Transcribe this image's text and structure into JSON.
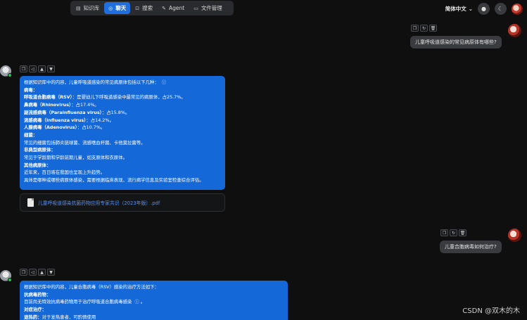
{
  "nav": {
    "tabs": [
      {
        "label": "知识库",
        "icon": "book-icon"
      },
      {
        "label": "聊天",
        "icon": "chat-icon",
        "active": true
      },
      {
        "label": "搜索",
        "icon": "search-icon"
      },
      {
        "label": "Agent",
        "icon": "agent-icon"
      },
      {
        "label": "文件管理",
        "icon": "folder-icon"
      }
    ],
    "language": "简体中文"
  },
  "messages": {
    "user1": "儿童呼吸道感染的常见病原体有哪些?",
    "bot1": {
      "intro": "根据知识库中的内容，儿童呼吸道感染的常见病原体包括以下几种：",
      "lines": [
        {
          "text": "病毒：",
          "bold": true
        },
        {
          "bold_part": "呼吸道合胞病毒（RSV）",
          "rest": "：是婴幼儿下呼吸道感染中最常见的病原体，占25.7%。"
        },
        {
          "bold_part": "鼻病毒（Rhinovirus）",
          "rest": "：占17.4%。"
        },
        {
          "bold_part": "副流感病毒（Parainfluenza virus）",
          "rest": "：占15.8%。"
        },
        {
          "bold_part": "流感病毒（Influenza virus）",
          "rest": "：占14.2%。"
        },
        {
          "bold_part": "人腺病毒（Adenovirus）",
          "rest": "：占10.7%。"
        },
        {
          "text": "细菌：",
          "bold": true
        },
        {
          "text": "常见的细菌包括肺炎链球菌、流感嗜血杆菌、卡他莫拉菌等。"
        },
        {
          "text": "非典型病原体：",
          "bold": true
        },
        {
          "text": "常见于学龄期和学龄前期儿童，如支原体和衣原体。"
        },
        {
          "text": "其他病原体：",
          "bold": true
        },
        {
          "text": "近年来，百日咳在我国也呈现上升趋势。"
        },
        {
          "text": "具体是哪种或哪些病原体感染，需要根据临床表现、流行病学信息及实验室检查综合评估。"
        }
      ],
      "file": "儿童呼吸道感染抗菌药物应用专家共识（2023年版）.pdf"
    },
    "user2": "儿童合胞病毒如何治疗?",
    "bot2": {
      "intro": "根据知识库中的内容，儿童合胞病毒（RSV）感染的治疗方法如下：",
      "lines": [
        {
          "text": "抗病毒药物：",
          "bold": true
        },
        {
          "text": "目前尚无特效抗病毒药物用于治疗呼吸道合胞病毒感染"
        },
        {
          "text": "对症治疗：",
          "bold": true
        },
        {
          "bold_part": "退热药：",
          "rest": "对于发热患者，可酌情使用"
        }
      ]
    }
  },
  "watermark": "CSDN @双木的木"
}
